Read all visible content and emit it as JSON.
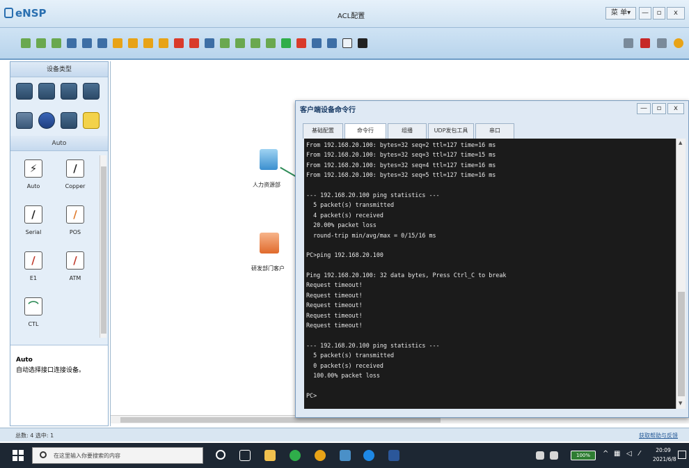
{
  "window": {
    "app_name": "eNSP",
    "title": "ACL配置",
    "menu_label": "菜 单▾",
    "minimize": "—",
    "maximize": "▫",
    "close": "x"
  },
  "left_panel": {
    "header": "设备类型",
    "category_label": "Auto",
    "cables": [
      {
        "label": "Auto",
        "glyph": "⚡",
        "color": "#222222"
      },
      {
        "label": "Copper",
        "glyph": "/",
        "color": "#222222"
      },
      {
        "label": "Serial",
        "glyph": "/",
        "color": "#222222"
      },
      {
        "label": "POS",
        "glyph": "/",
        "color": "#e07a2a"
      },
      {
        "label": "E1",
        "glyph": "/",
        "color": "#c0392b"
      },
      {
        "label": "ATM",
        "glyph": "/",
        "color": "#c0392b"
      },
      {
        "label": "CTL",
        "glyph": "⌒",
        "color": "#2e8b57"
      }
    ],
    "desc_title": "Auto",
    "desc_text": "自动选择接口连接设备。"
  },
  "canvas": {
    "devices": [
      {
        "label": "人力资源部",
        "icon": "pc-icon"
      },
      {
        "label": "研发部门客户",
        "icon": "pc-icon"
      }
    ]
  },
  "cli_window": {
    "title": "客户端设备命令行",
    "tabs": [
      "基础配置",
      "命令行",
      "组播",
      "UDP发包工具",
      "串口"
    ],
    "active_tab": 1,
    "lines": [
      "From 192.168.20.100: bytes=32 seq=2 ttl=127 time=16 ms",
      "From 192.168.20.100: bytes=32 seq=3 ttl=127 time=15 ms",
      "From 192.168.20.100: bytes=32 seq=4 ttl=127 time=16 ms",
      "From 192.168.20.100: bytes=32 seq=5 ttl=127 time=16 ms",
      "",
      "--- 192.168.20.100 ping statistics ---",
      "  5 packet(s) transmitted",
      "  4 packet(s) received",
      "  20.00% packet loss",
      "  round-trip min/avg/max = 0/15/16 ms",
      "",
      "PC>ping 192.168.20.100",
      "",
      "Ping 192.168.20.100: 32 data bytes, Press Ctrl_C to break",
      "Request timeout!",
      "Request timeout!",
      "Request timeout!",
      "Request timeout!",
      "Request timeout!",
      "",
      "--- 192.168.20.100 ping statistics ---",
      "  5 packet(s) transmitted",
      "  0 packet(s) received",
      "  100.00% packet loss",
      "",
      "PC>"
    ]
  },
  "statusbar": {
    "left": "总数: 4 选中: 1",
    "right": "获取帮助与反馈"
  },
  "taskbar": {
    "search_placeholder": "在这里输入你要搜索的内容",
    "battery": "100%",
    "time": "20:09",
    "date": "2021/6/8"
  }
}
